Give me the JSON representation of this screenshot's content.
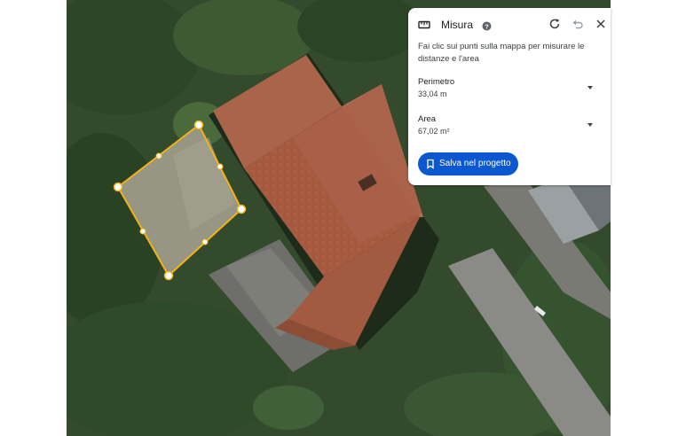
{
  "map": {
    "view": "satellite",
    "measurement_color": "#f2b21b"
  },
  "panel": {
    "icon": "ruler-icon",
    "title": "Misura",
    "help_icon": "help-icon",
    "description": "Fai clic sui punti sulla mappa per misurare le distanze e l'area",
    "perimeter": {
      "label": "Perimetro",
      "value": "33,04 m"
    },
    "area": {
      "label": "Area",
      "value": "67,02 m²"
    },
    "save_label": "Salva nel progetto",
    "accent_color": "#0b57d0"
  }
}
